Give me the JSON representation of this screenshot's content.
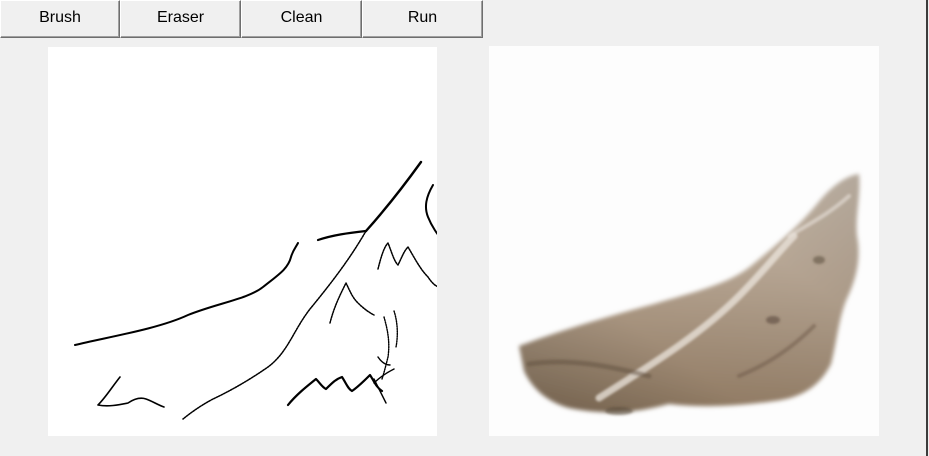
{
  "toolbar": {
    "brush_label": "Brush",
    "eraser_label": "Eraser",
    "clean_label": "Clean",
    "run_label": "Run"
  },
  "colors": {
    "window_bg": "#f0f0f0",
    "canvas_bg": "#ffffff",
    "stroke": "#000000",
    "output_tone": "#a8927a"
  }
}
